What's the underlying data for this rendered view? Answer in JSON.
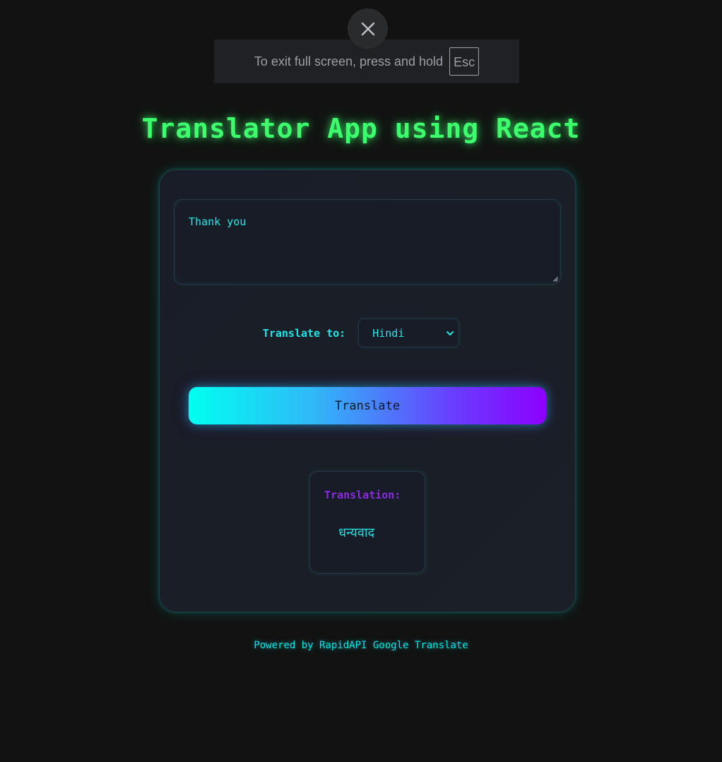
{
  "fullscreen_notice": {
    "message": "To exit full screen, press and hold",
    "key": "Esc"
  },
  "app": {
    "title": "Translator App using React"
  },
  "input": {
    "value": "Thank you"
  },
  "language": {
    "label": "Translate to:",
    "selected": "Hindi"
  },
  "actions": {
    "translate_label": "Translate"
  },
  "result": {
    "label": "Translation:",
    "text": "धन्यवाद"
  },
  "footer": {
    "text": "Powered by RapidAPI Google Translate"
  },
  "colors": {
    "page_background": "#121212",
    "title_green": "#3dff6e",
    "accent_cyan": "#00e5e5",
    "accent_purple": "#8a2be2"
  }
}
